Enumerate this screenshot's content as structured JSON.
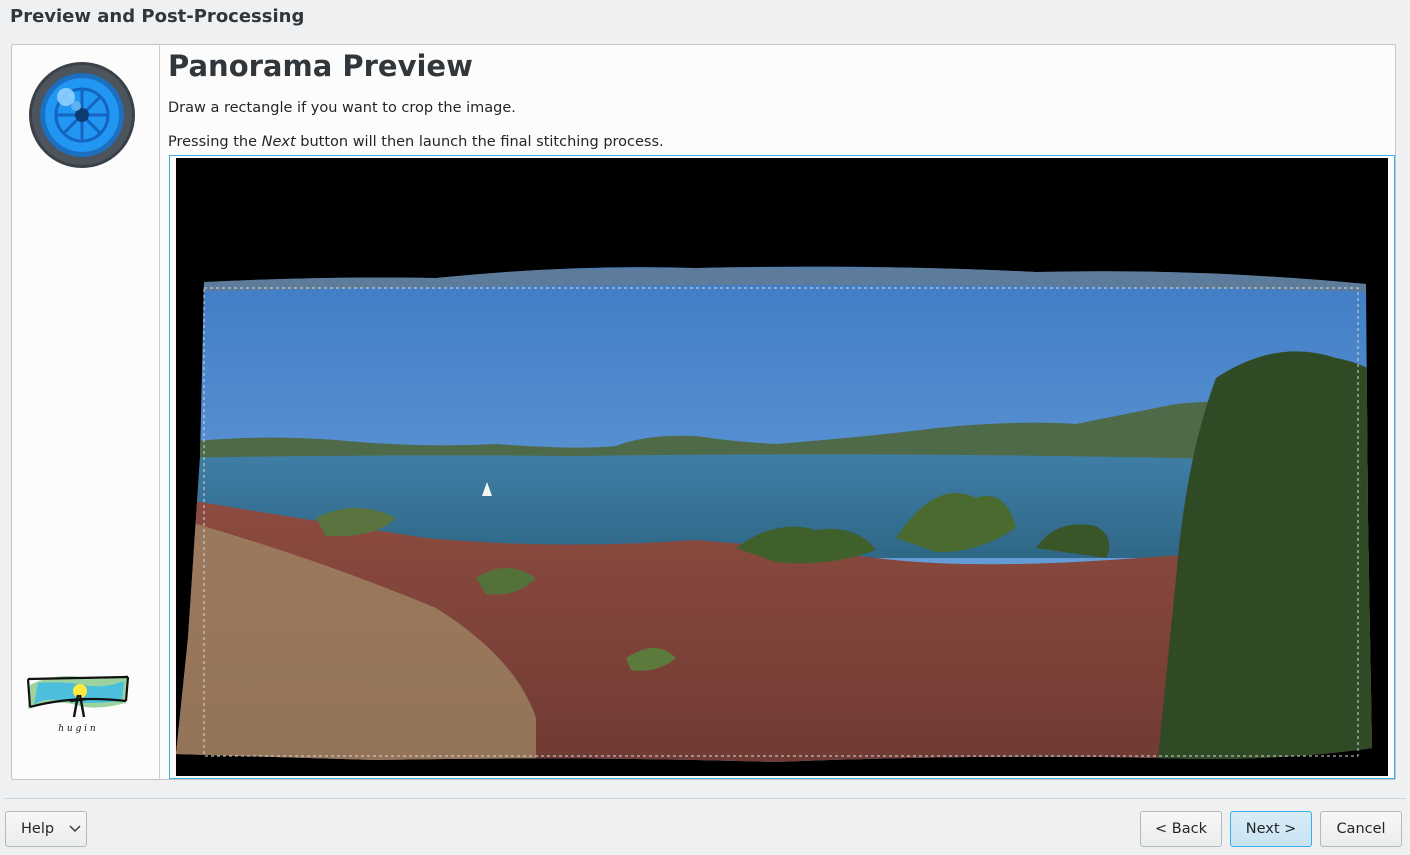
{
  "window": {
    "title": "Preview and Post-Processing"
  },
  "page": {
    "title": "Panorama Preview",
    "instruction1": "Draw a rectangle if you want to crop the image.",
    "instruction2_pre": "Pressing the ",
    "instruction2_em": "Next",
    "instruction2_post": " button will then launch the final stitching process."
  },
  "sidebar": {
    "icon": "camera-lens-icon",
    "logo": "hugin-logo",
    "logo_text": "h u g i n"
  },
  "preview": {
    "description": "panorama-image",
    "crop_selection": "dashed-rectangle"
  },
  "buttons": {
    "help": "Help",
    "back": "< Back",
    "next": "Next >",
    "cancel": "Cancel"
  },
  "colors": {
    "accent": "#3daee9",
    "background": "#eff0f1",
    "lens_blue": "#1e88e5"
  }
}
